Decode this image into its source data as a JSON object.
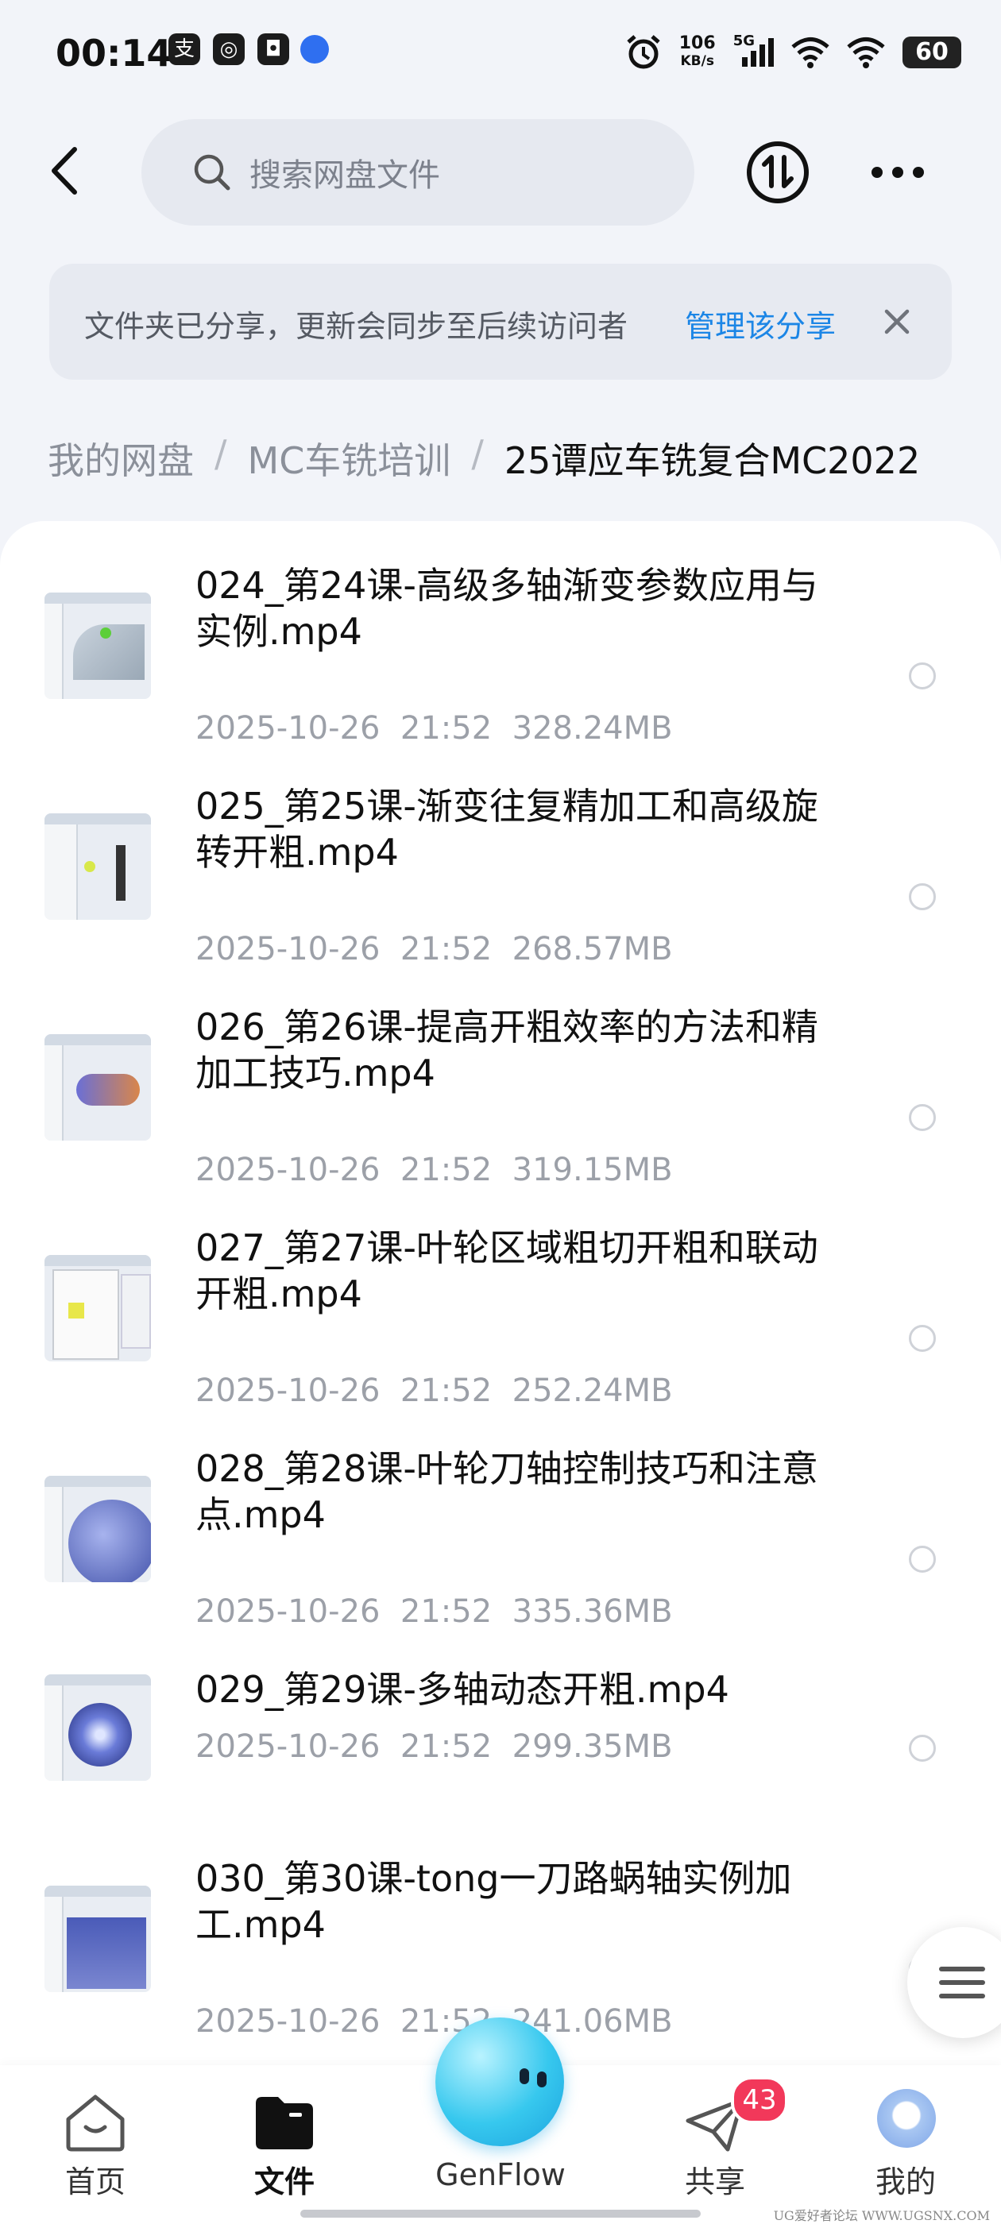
{
  "status_bar": {
    "time": "00:14",
    "net_speed_value": "106",
    "net_speed_unit": "KB/s",
    "network": "5G",
    "battery": "60"
  },
  "search": {
    "placeholder": "搜索网盘文件"
  },
  "banner": {
    "text": "文件夹已分享，更新会同步至后续访问者",
    "link": "管理该分享"
  },
  "breadcrumb": {
    "items": [
      "我的网盘",
      "MC车铣培训",
      "25谭应车铣复合MC2022"
    ],
    "separator": "/"
  },
  "files": [
    {
      "title": "024_第24课-高级多轴渐变参数应用与实例.mp4",
      "date": "2025-10-26",
      "time": "21:52",
      "size": "328.24MB"
    },
    {
      "title": "025_第25课-渐变往复精加工和高级旋转开粗.mp4",
      "date": "2025-10-26",
      "time": "21:52",
      "size": "268.57MB"
    },
    {
      "title": "026_第26课-提高开粗效率的方法和精加工技巧.mp4",
      "date": "2025-10-26",
      "time": "21:52",
      "size": "319.15MB"
    },
    {
      "title": "027_第27课-叶轮区域粗切开粗和联动开粗.mp4",
      "date": "2025-10-26",
      "time": "21:52",
      "size": "252.24MB"
    },
    {
      "title": "028_第28课-叶轮刀轴控制技巧和注意点.mp4",
      "date": "2025-10-26",
      "time": "21:52",
      "size": "335.36MB"
    },
    {
      "title": "029_第29课-多轴动态开粗.mp4",
      "date": "2025-10-26",
      "time": "21:52",
      "size": "299.35MB"
    },
    {
      "title": "030_第30课-tong一刀路蜗轴实例加工.mp4",
      "date": "2025-10-26",
      "time": "21:52",
      "size": "241.06MB"
    }
  ],
  "bottom_nav": {
    "home": "首页",
    "files": "文件",
    "genflow": "GenFlow",
    "share": "共享",
    "share_badge": "43",
    "mine": "我的"
  },
  "watermark": "UG爱好者论坛 WWW.UGSNX.COM",
  "colors": {
    "accent": "#1c86e6",
    "badge": "#f2385a",
    "genflow": "#37c8ee"
  }
}
